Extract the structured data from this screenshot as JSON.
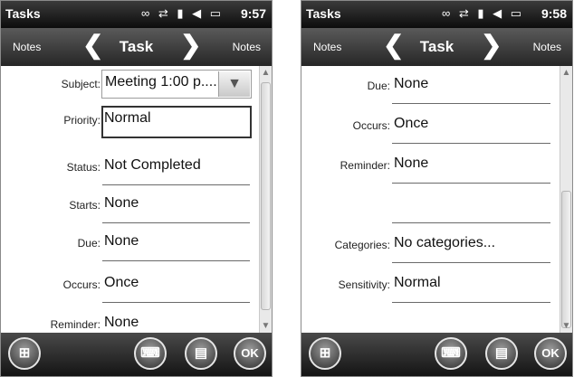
{
  "status_bar": {
    "app_title": "Tasks",
    "time_left": "9:57",
    "time_right": "9:58",
    "icons": [
      "eco-icon",
      "sync-arrows-icon",
      "signal-icon",
      "volume-icon",
      "battery-icon"
    ],
    "icon_glyphs": "∞ ⇄ ▮ ◀ ▭"
  },
  "nav": {
    "left_label": "Notes",
    "title": "Task",
    "right_label": "Notes",
    "prev_glyph": "❮",
    "next_glyph": "❯"
  },
  "left_form": {
    "subject": {
      "label": "Subject:",
      "value": "Meeting 1:00 p...."
    },
    "priority": {
      "label": "Priority:",
      "value": "Normal"
    },
    "status": {
      "label": "Status:",
      "value": "Not Completed"
    },
    "starts": {
      "label": "Starts:",
      "value": "None"
    },
    "due": {
      "label": "Due:",
      "value": "None"
    },
    "occurs": {
      "label": "Occurs:",
      "value": "Once"
    },
    "reminder": {
      "label": "Reminder:",
      "value": "None"
    }
  },
  "right_form": {
    "due": {
      "label": "Due:",
      "value": "None"
    },
    "occurs": {
      "label": "Occurs:",
      "value": "Once"
    },
    "reminder": {
      "label": "Reminder:",
      "value": "None"
    },
    "blank": {
      "label": "",
      "value": ""
    },
    "categories": {
      "label": "Categories:",
      "value": "No categories..."
    },
    "sensitivity": {
      "label": "Sensitivity:",
      "value": "Normal"
    }
  },
  "bottom_bar": {
    "start_glyph": "⊞",
    "keyboard_glyph": "⌨",
    "menu_glyph": "▤",
    "ok_label": "OK"
  },
  "colors": {
    "bar_dark": "#141414",
    "bar_mid": "#4a4a4a",
    "field_line": "#6a6a6a"
  }
}
